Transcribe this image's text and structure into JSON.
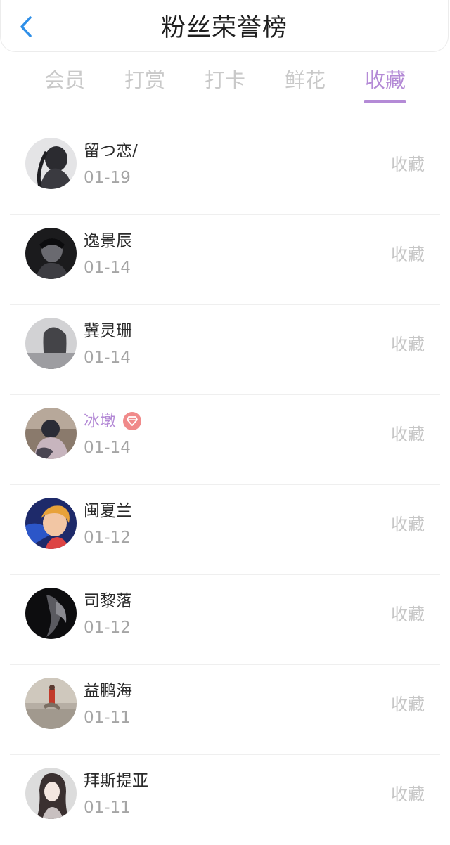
{
  "header": {
    "title": "粉丝荣誉榜",
    "back_icon": "chevron-left-icon",
    "accent_color": "#2f8fe8"
  },
  "tabs": [
    {
      "label": "会员",
      "active": false
    },
    {
      "label": "打赏",
      "active": false
    },
    {
      "label": "打卡",
      "active": false
    },
    {
      "label": "鲜花",
      "active": false
    },
    {
      "label": "收藏",
      "active": true
    }
  ],
  "theme": {
    "active_color": "#b48ad6",
    "inactive_color": "#c9c9c9",
    "vip_badge_color": "#f08a8a"
  },
  "list": [
    {
      "name": "留つ恋/",
      "date": "01-19",
      "action": "收藏",
      "vip": false
    },
    {
      "name": "逸景辰",
      "date": "01-14",
      "action": "收藏",
      "vip": false
    },
    {
      "name": "冀灵珊",
      "date": "01-14",
      "action": "收藏",
      "vip": false
    },
    {
      "name": "冰墩",
      "date": "01-14",
      "action": "收藏",
      "vip": true,
      "badge_icon": "diamond-vip-icon"
    },
    {
      "name": "闽夏兰",
      "date": "01-12",
      "action": "收藏",
      "vip": false
    },
    {
      "name": "司黎落",
      "date": "01-12",
      "action": "收藏",
      "vip": false
    },
    {
      "name": "益鹏海",
      "date": "01-11",
      "action": "收藏",
      "vip": false
    },
    {
      "name": "拜斯提亚",
      "date": "01-11",
      "action": "收藏",
      "vip": false
    }
  ]
}
